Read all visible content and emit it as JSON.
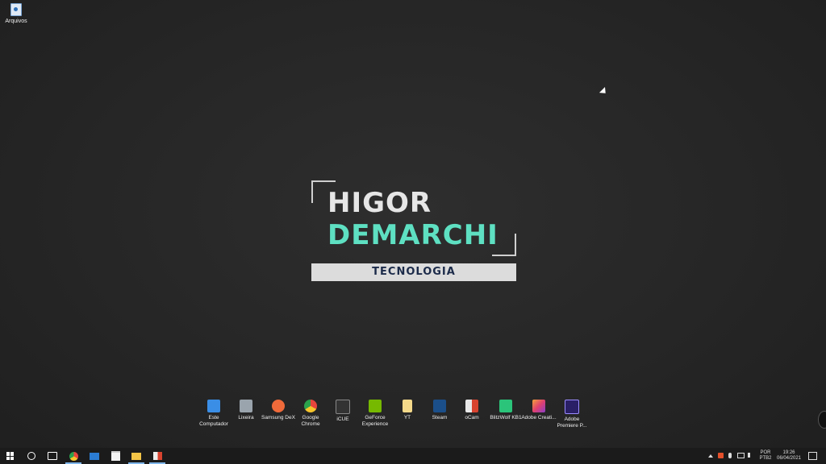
{
  "desktop": {
    "top_icon_label": "Arquivos",
    "logo": {
      "line1": "HIGOR",
      "line2": "DEMARCHI",
      "tagline": "TECNOLOGIA"
    },
    "icons": [
      {
        "label": "Este Computador",
        "icon": "computer-icon",
        "color": "#3a8ee6"
      },
      {
        "label": "Lixeira",
        "icon": "recycle-bin-icon",
        "color": "#9aa4ad"
      },
      {
        "label": "Samsung DeX",
        "icon": "samsung-dex-icon",
        "color": "#f06a3a"
      },
      {
        "label": "Google Chrome",
        "icon": "chrome-icon",
        "color": "#e8453c"
      },
      {
        "label": "iCUE",
        "icon": "icue-icon",
        "color": "#333333"
      },
      {
        "label": "GeForce Experience",
        "icon": "geforce-icon",
        "color": "#76b900"
      },
      {
        "label": "YT",
        "icon": "file-icon",
        "color": "#f4d98a"
      },
      {
        "label": "Steam",
        "icon": "steam-icon",
        "color": "#1b4f8a"
      },
      {
        "label": "oCam",
        "icon": "ocam-icon",
        "color": "#e8e8e8"
      },
      {
        "label": "BlitzWolf KB1",
        "icon": "blitzwolf-icon",
        "color": "#2bc47a"
      },
      {
        "label": "Adobe Creati...",
        "icon": "adobe-cc-icon",
        "color": "#e0406f"
      },
      {
        "label": "Adobe Premiere P...",
        "icon": "premiere-icon",
        "color": "#2a1f66"
      }
    ]
  },
  "taskbar": {
    "language_top": "POR",
    "language_bottom": "PTB2",
    "time": "19:26",
    "date": "06/04/2021"
  }
}
